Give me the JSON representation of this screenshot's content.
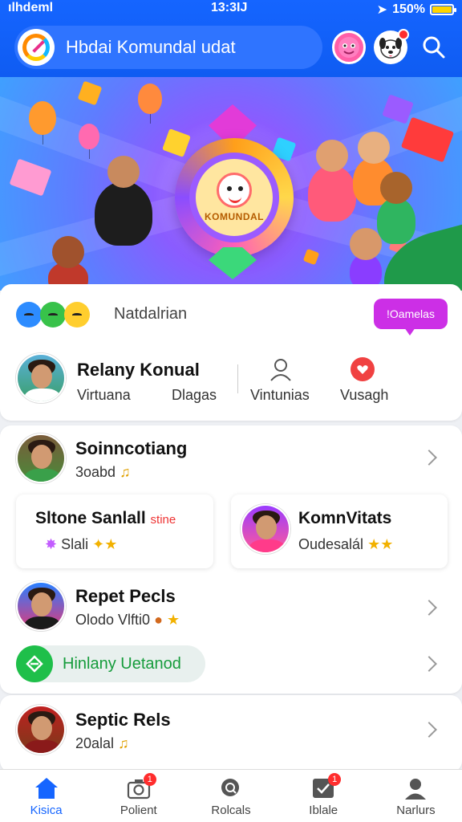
{
  "status_bar": {
    "carrier": "ılhdeml",
    "time": "13:3IJ",
    "battery": "150%",
    "battery_level_percent": 100
  },
  "header": {
    "title": "Hbdai Komundal udat",
    "search_icon": "search-icon"
  },
  "banner": {
    "emblem_text": "KOMUNDAL"
  },
  "section": {
    "label": "Natdalrian",
    "action_label": "!Oamelas",
    "featured": {
      "name": "Relany Konual",
      "sub1": "Virtuana",
      "sub2": "Dlagas"
    },
    "actions": [
      {
        "icon": "user-icon",
        "label": "Vintunias"
      },
      {
        "icon": "heart-icon",
        "label": "Vusagh"
      }
    ]
  },
  "list": {
    "item1": {
      "name": "Soinncotiang",
      "sub": "3oabd",
      "emoji": "♫"
    },
    "card_left": {
      "title": "Sltone Sanlall",
      "tag": "stine",
      "sub": "Slali",
      "emoji": "✦★"
    },
    "card_right": {
      "title": "KomnVitats",
      "sub": "Oudesalál",
      "emoji": "★★"
    },
    "item2": {
      "name": "Repet Pecls",
      "sub": "Olodo Vlfti0",
      "emoji": "★"
    },
    "green_button": "Hinlany Uetanod",
    "item3": {
      "name": "Septic Rels",
      "sub": "20alal",
      "emoji": "♫"
    }
  },
  "bottom_nav": [
    {
      "label": "Kisica",
      "icon": "home-icon",
      "active": true,
      "badge": ""
    },
    {
      "label": "Polient",
      "icon": "camera-icon",
      "active": false,
      "badge": "1"
    },
    {
      "label": "Rolcals",
      "icon": "search-chat-icon",
      "active": false,
      "badge": ""
    },
    {
      "label": "Iblale",
      "icon": "check-box-icon",
      "active": false,
      "badge": "1"
    },
    {
      "label": "Narlurs",
      "icon": "profile-icon",
      "active": false,
      "badge": ""
    }
  ],
  "colors": {
    "primary": "#1565ff",
    "accent_purple": "#cc2fe6",
    "green": "#1fbf4a",
    "badge_red": "#ff2d2d"
  }
}
